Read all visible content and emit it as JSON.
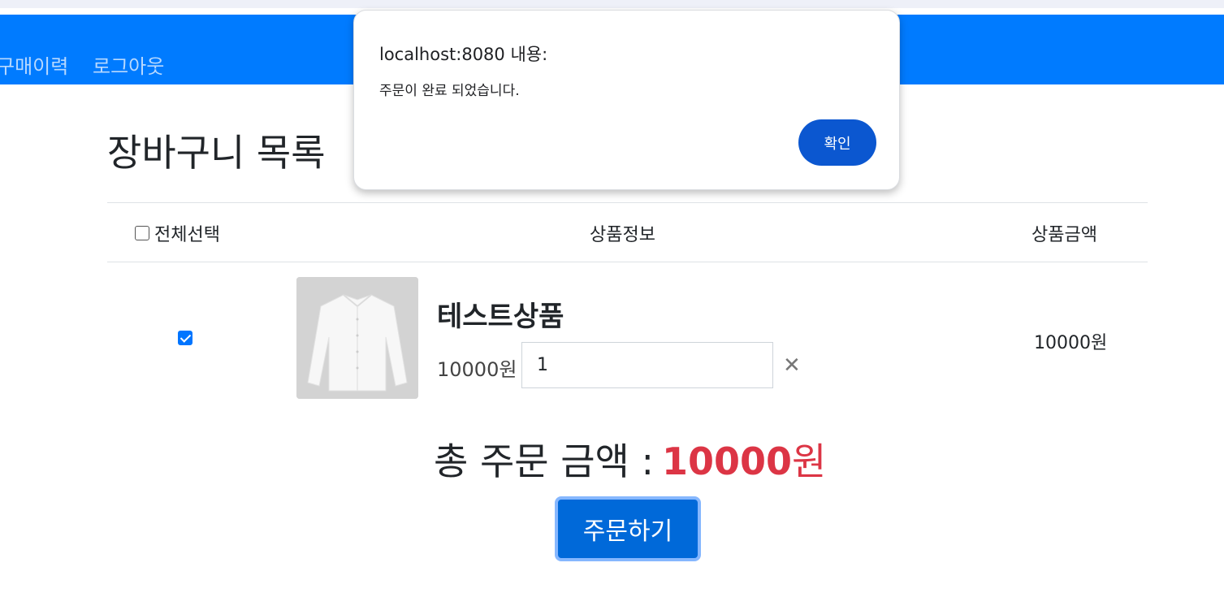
{
  "navbar": {
    "orders_link": "구매이력",
    "logout_link": "로그아웃",
    "bg_color": "#007bff"
  },
  "page": {
    "title": "장바구니 목록"
  },
  "table": {
    "headers": {
      "select_all": "전체선택",
      "product_info": "상품정보",
      "product_price": "상품금액"
    },
    "rows": [
      {
        "checked": true,
        "product_name": "테스트상품",
        "unit_price": "10000원",
        "quantity": "1",
        "row_price": "10000원",
        "image_icon": "shirt-image"
      }
    ]
  },
  "summary": {
    "label": "총 주문 금액 :",
    "amount": "10000",
    "currency": "원",
    "accent_color": "#dc3545"
  },
  "order_button": {
    "label": "주문하기"
  },
  "alert_dialog": {
    "title": "localhost:8080 내용:",
    "message": "주문이 완료 되었습니다.",
    "ok_label": "확인",
    "accent_color": "#0b57d0"
  },
  "icons": {
    "remove": "close-icon"
  }
}
